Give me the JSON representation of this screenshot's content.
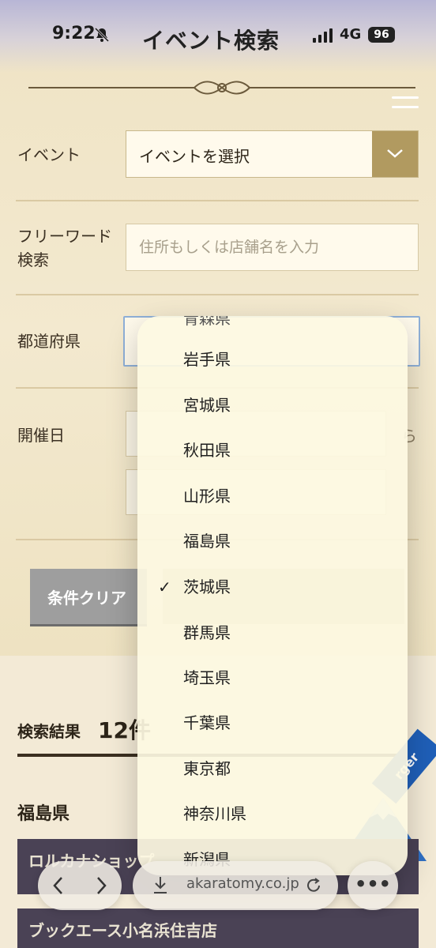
{
  "status_bar": {
    "time": "9:22",
    "network": "4G",
    "battery": "96"
  },
  "header": {
    "title": "イベント検索"
  },
  "form": {
    "event_label": "イベント",
    "event_select_value": "イベントを選択",
    "freeword_label_line1": "フリーワード",
    "freeword_label_line2": "検索",
    "freeword_placeholder": "住所もしくは店舗名を入力",
    "prefecture_label": "都道府県",
    "date_label": "開催日",
    "date_from_suffix": "ら",
    "clear_button": "条件クリア"
  },
  "results": {
    "label": "検索結果",
    "count": "12件",
    "prefecture_heading": "福島県"
  },
  "shop_cards": [
    "ロルカナショップ",
    "ブックエース小名浜住吉店"
  ],
  "ribbon_text": "rger",
  "dropdown": {
    "partial_top": "青森県",
    "options": [
      "岩手県",
      "宮城県",
      "秋田県",
      "山形県",
      "福島県",
      "茨城県",
      "群馬県",
      "埼玉県",
      "千葉県",
      "東京都",
      "神奈川県",
      "新潟県"
    ],
    "selected": "茨城県",
    "check_mark": "✓"
  },
  "browser": {
    "url": "akaratomy.co.jp",
    "more": "•••"
  },
  "colors": {
    "accent_gold": "#b19a60",
    "ribbon_blue": "#1f5fb8"
  }
}
